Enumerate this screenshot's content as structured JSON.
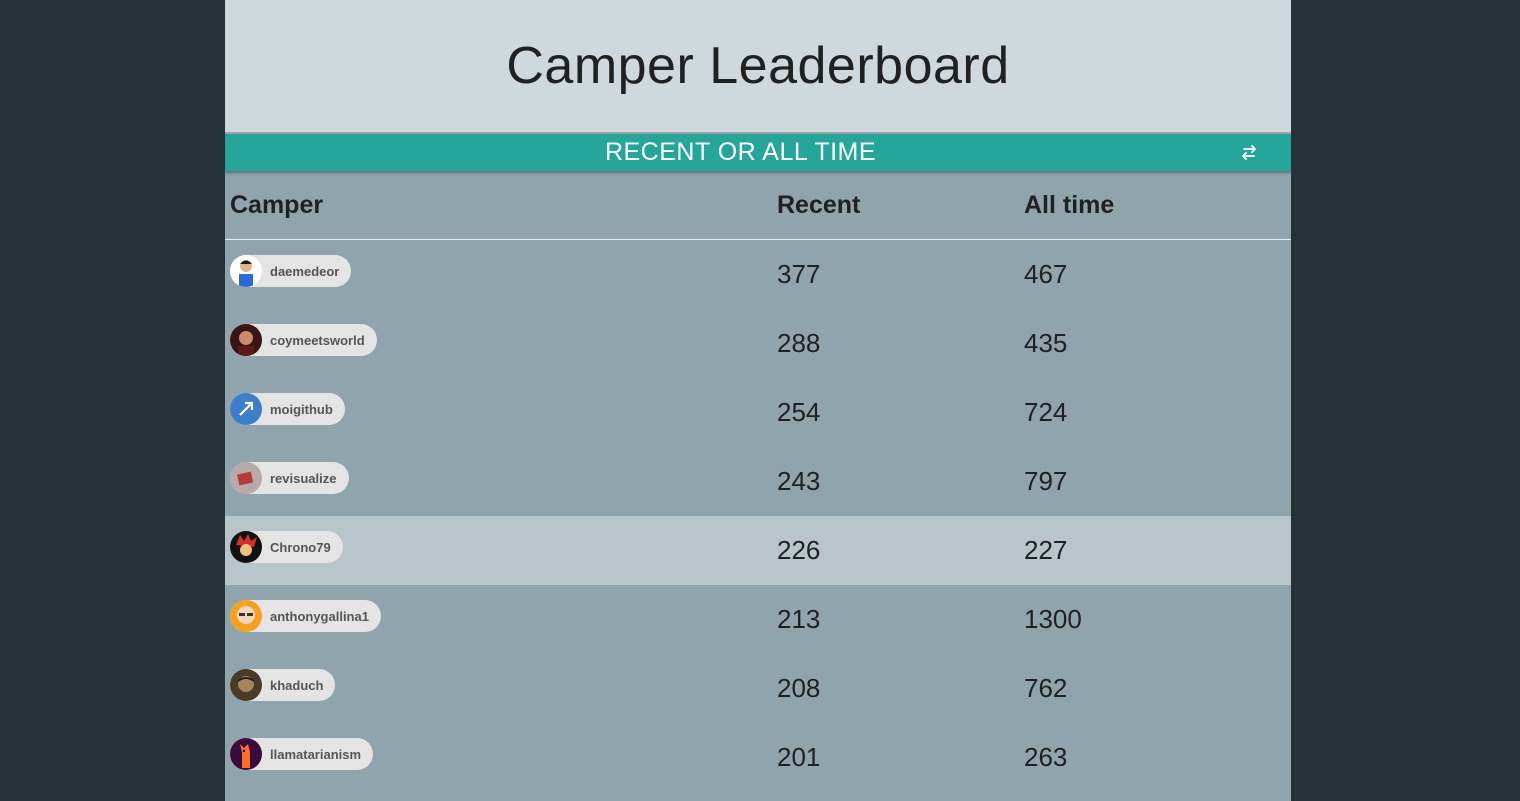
{
  "header": {
    "title": "Camper Leaderboard"
  },
  "toggle": {
    "label": "RECENT OR ALL TIME",
    "icon": "swap-horizontal-icon"
  },
  "table": {
    "columns": [
      "Camper",
      "Recent",
      "All time"
    ],
    "rows": [
      {
        "username": "daemedeor",
        "recent": "377",
        "alltime": "467"
      },
      {
        "username": "coymeetsworld",
        "recent": "288",
        "alltime": "435"
      },
      {
        "username": "moigithub",
        "recent": "254",
        "alltime": "724"
      },
      {
        "username": "revisualize",
        "recent": "243",
        "alltime": "797"
      },
      {
        "username": "Chrono79",
        "recent": "226",
        "alltime": "227"
      },
      {
        "username": "anthonygallina1",
        "recent": "213",
        "alltime": "1300"
      },
      {
        "username": "khaduch",
        "recent": "208",
        "alltime": "762"
      },
      {
        "username": "llamatarianism",
        "recent": "201",
        "alltime": "263"
      }
    ]
  },
  "colors": {
    "background": "#263238",
    "header_bg": "#cfd8dc",
    "toggle_bg": "#26a69a",
    "table_bg": "#90a4ae",
    "row_highlight": "#b8c5cb"
  }
}
